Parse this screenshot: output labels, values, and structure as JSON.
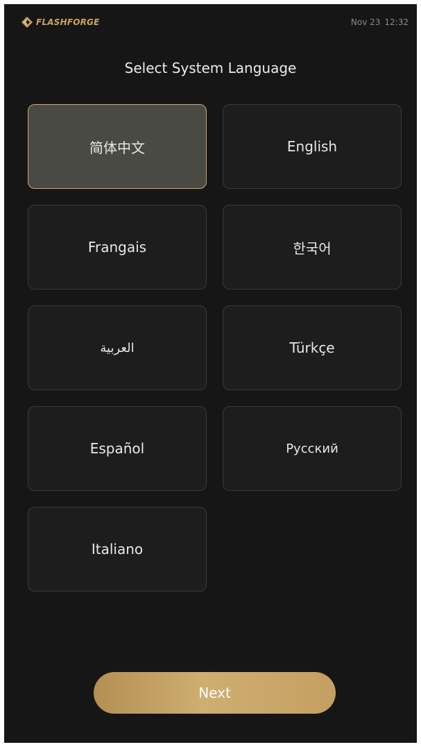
{
  "status_bar": {
    "brand_name": "FLASHFORGE",
    "date": "Nov 23",
    "time": "12:32"
  },
  "page_title": "Select System Language",
  "languages": [
    {
      "label": "简体中文",
      "selected": true
    },
    {
      "label": "English",
      "selected": false
    },
    {
      "label": "Frangais",
      "selected": false
    },
    {
      "label": "한국어",
      "selected": false
    },
    {
      "label": "العربية",
      "selected": false
    },
    {
      "label": "Türkçe",
      "selected": false
    },
    {
      "label": "Español",
      "selected": false
    },
    {
      "label": "Русский",
      "selected": false
    },
    {
      "label": "Italiano",
      "selected": false
    }
  ],
  "next_button": {
    "label": "Next"
  },
  "colors": {
    "background": "#161616",
    "accent_gold": "#c9a35e",
    "card_border": "#3a3a3a",
    "selected_card_bg": "#4a4a44",
    "selected_card_border": "#c9a86c"
  },
  "icons": {
    "brand_logo": "flashforge-logo-icon"
  }
}
